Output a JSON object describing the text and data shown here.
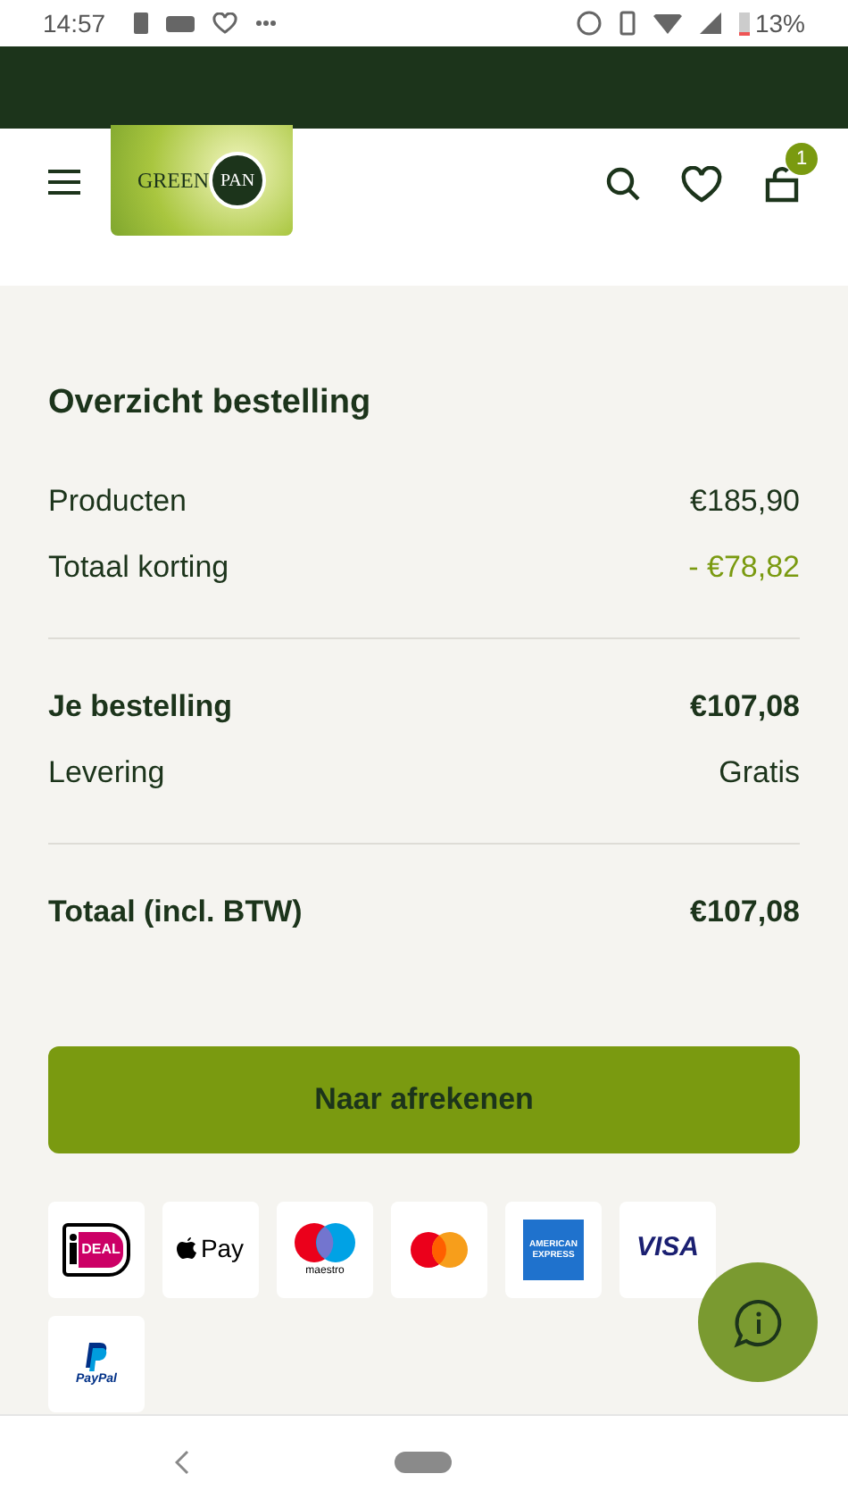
{
  "status_bar": {
    "time": "14:57",
    "battery": "13%"
  },
  "header": {
    "logo": {
      "word_1": "GREEN",
      "word_2": "PAN"
    },
    "cart_count": "1"
  },
  "summary": {
    "title": "Overzicht bestelling",
    "groups": [
      [
        {
          "label": "Producten",
          "value": "€185,90",
          "kind": "plain"
        },
        {
          "label": "Totaal korting",
          "value": "- €78,82",
          "kind": "discount"
        }
      ],
      [
        {
          "label": "Je bestelling",
          "value": "€107,08",
          "kind": "bold"
        },
        {
          "label": "Levering",
          "value": "Gratis",
          "kind": "plain"
        }
      ],
      [
        {
          "label": "Totaal (incl. BTW)",
          "value": "€107,08",
          "kind": "bold"
        }
      ]
    ]
  },
  "checkout_button": "Naar afrekenen",
  "payment_methods": [
    {
      "kind": "ideal",
      "text": "DEAL"
    },
    {
      "kind": "applepay",
      "text": "Pay"
    },
    {
      "kind": "maestro",
      "text": "maestro"
    },
    {
      "kind": "mastercard"
    },
    {
      "kind": "amex",
      "text": "AMERICAN EXPRESS"
    },
    {
      "kind": "visa",
      "text": "VISA"
    },
    {
      "kind": "paypal",
      "text": "PayPal"
    }
  ]
}
